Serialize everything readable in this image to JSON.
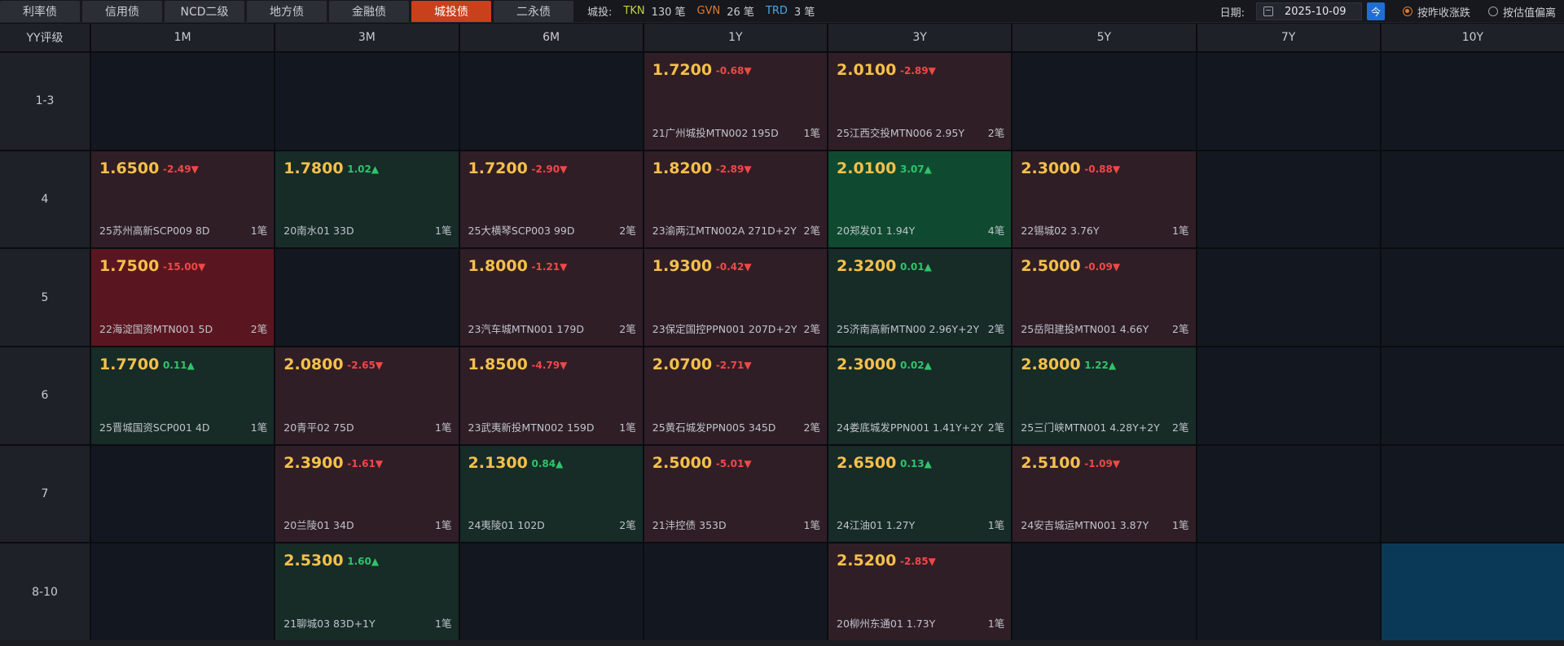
{
  "tabs": [
    {
      "label": "利率债",
      "active": false
    },
    {
      "label": "信用债",
      "active": false
    },
    {
      "label": "NCD二级",
      "active": false
    },
    {
      "label": "地方债",
      "active": false
    },
    {
      "label": "金融债",
      "active": false
    },
    {
      "label": "城投债",
      "active": true
    },
    {
      "label": "二永债",
      "active": false
    }
  ],
  "summary": {
    "label": "城投:",
    "items": [
      {
        "key": "TKN",
        "value": "130 笔",
        "color": "#c8d23a"
      },
      {
        "key": "GVN",
        "value": "26 笔",
        "color": "#e07a2a"
      },
      {
        "key": "TRD",
        "value": "3 笔",
        "color": "#4aa6e8"
      }
    ]
  },
  "date": {
    "label": "日期:",
    "value": "2025-10-09",
    "today_label": "今"
  },
  "radios": [
    {
      "label": "按昨收涨跌",
      "checked": true
    },
    {
      "label": "按估值偏离",
      "checked": false
    }
  ],
  "grid": {
    "corner": "YY评级",
    "columns": [
      "1M",
      "3M",
      "6M",
      "1Y",
      "3Y",
      "5Y",
      "7Y",
      "10Y"
    ],
    "rows": [
      {
        "label": "1-3",
        "cells": [
          null,
          null,
          null,
          {
            "yield": "1.7200",
            "chg": "-0.68▼",
            "dir": "down",
            "bond": "21广州城投MTN002 195D",
            "count": "1笔",
            "tone": "red"
          },
          {
            "yield": "2.0100",
            "chg": "-2.89▼",
            "dir": "down",
            "bond": "25江西交投MTN006 2.95Y",
            "count": "2笔",
            "tone": "red"
          },
          null,
          null,
          null
        ]
      },
      {
        "label": "4",
        "cells": [
          {
            "yield": "1.6500",
            "chg": "-2.49▼",
            "dir": "down",
            "bond": "25苏州高新SCP009 8D",
            "count": "1笔",
            "tone": "red"
          },
          {
            "yield": "1.7800",
            "chg": "1.02▲",
            "dir": "up",
            "bond": "20南水01 33D",
            "count": "1笔",
            "tone": "green"
          },
          {
            "yield": "1.7200",
            "chg": "-2.90▼",
            "dir": "down",
            "bond": "25大横琴SCP003 99D",
            "count": "2笔",
            "tone": "red"
          },
          {
            "yield": "1.8200",
            "chg": "-2.89▼",
            "dir": "down",
            "bond": "23渝两江MTN002A 271D+2Y",
            "count": "2笔",
            "tone": "red"
          },
          {
            "yield": "2.0100",
            "chg": "3.07▲",
            "dir": "up",
            "bond": "20郑发01 1.94Y",
            "count": "4笔",
            "tone": "brightgreen"
          },
          {
            "yield": "2.3000",
            "chg": "-0.88▼",
            "dir": "down",
            "bond": "22锡城02 3.76Y",
            "count": "1笔",
            "tone": "red"
          },
          null,
          null
        ]
      },
      {
        "label": "5",
        "cells": [
          {
            "yield": "1.7500",
            "chg": "-15.00▼",
            "dir": "down",
            "bond": "22海淀国资MTN001 5D",
            "count": "2笔",
            "tone": "deepred"
          },
          null,
          {
            "yield": "1.8000",
            "chg": "-1.21▼",
            "dir": "down",
            "bond": "23汽车城MTN001 179D",
            "count": "2笔",
            "tone": "red"
          },
          {
            "yield": "1.9300",
            "chg": "-0.42▼",
            "dir": "down",
            "bond": "23保定国控PPN001 207D+2Y",
            "count": "2笔",
            "tone": "red"
          },
          {
            "yield": "2.3200",
            "chg": "0.01▲",
            "dir": "up",
            "bond": "25济南高新MTN00 2.96Y+2Y",
            "count": "2笔",
            "tone": "green"
          },
          {
            "yield": "2.5000",
            "chg": "-0.09▼",
            "dir": "down",
            "bond": "25岳阳建投MTN001 4.66Y",
            "count": "2笔",
            "tone": "red"
          },
          null,
          null
        ]
      },
      {
        "label": "6",
        "cells": [
          {
            "yield": "1.7700",
            "chg": "0.11▲",
            "dir": "up",
            "bond": "25晋城国资SCP001 4D",
            "count": "1笔",
            "tone": "green"
          },
          {
            "yield": "2.0800",
            "chg": "-2.65▼",
            "dir": "down",
            "bond": "20青平02 75D",
            "count": "1笔",
            "tone": "red"
          },
          {
            "yield": "1.8500",
            "chg": "-4.79▼",
            "dir": "down",
            "bond": "23武夷新投MTN002 159D",
            "count": "1笔",
            "tone": "red"
          },
          {
            "yield": "2.0700",
            "chg": "-2.71▼",
            "dir": "down",
            "bond": "25黄石城发PPN005 345D",
            "count": "2笔",
            "tone": "red"
          },
          {
            "yield": "2.3000",
            "chg": "0.02▲",
            "dir": "up",
            "bond": "24娄底城发PPN001 1.41Y+2Y",
            "count": "2笔",
            "tone": "green"
          },
          {
            "yield": "2.8000",
            "chg": "1.22▲",
            "dir": "up",
            "bond": "25三门峡MTN001 4.28Y+2Y",
            "count": "2笔",
            "tone": "green"
          },
          null,
          null
        ]
      },
      {
        "label": "7",
        "cells": [
          null,
          {
            "yield": "2.3900",
            "chg": "-1.61▼",
            "dir": "down",
            "bond": "20兰陵01 34D",
            "count": "1笔",
            "tone": "red"
          },
          {
            "yield": "2.1300",
            "chg": "0.84▲",
            "dir": "up",
            "bond": "24夷陵01 102D",
            "count": "2笔",
            "tone": "green"
          },
          {
            "yield": "2.5000",
            "chg": "-5.01▼",
            "dir": "down",
            "bond": "21沣控债 353D",
            "count": "1笔",
            "tone": "red"
          },
          {
            "yield": "2.6500",
            "chg": "0.13▲",
            "dir": "up",
            "bond": "24江油01 1.27Y",
            "count": "1笔",
            "tone": "green"
          },
          {
            "yield": "2.5100",
            "chg": "-1.09▼",
            "dir": "down",
            "bond": "24安吉城运MTN001 3.87Y",
            "count": "1笔",
            "tone": "red"
          },
          null,
          null
        ]
      },
      {
        "label": "8-10",
        "cells": [
          null,
          {
            "yield": "2.5300",
            "chg": "1.60▲",
            "dir": "up",
            "bond": "21聊城03 83D+1Y",
            "count": "1笔",
            "tone": "green"
          },
          null,
          null,
          {
            "yield": "2.5200",
            "chg": "-2.85▼",
            "dir": "down",
            "bond": "20柳州东通01 1.73Y",
            "count": "1笔",
            "tone": "red"
          },
          null,
          null,
          {
            "empty_tone": "blue"
          }
        ]
      }
    ]
  }
}
